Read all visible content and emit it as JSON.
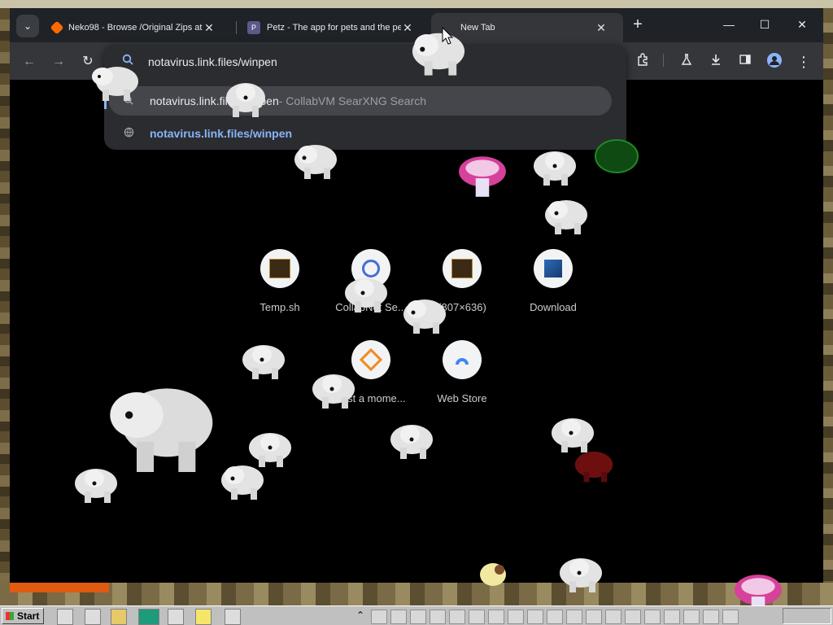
{
  "tabs": [
    {
      "title": "Neko98 - Browse /Original Zips at",
      "favicon": "sourceforge-diamond-icon",
      "favicon_color": "#ff6a00",
      "active": false
    },
    {
      "title": "Petz - The app for pets and the pe",
      "favicon": "petz-icon",
      "favicon_color": "#5a5a8a",
      "active": false
    },
    {
      "title": "New Tab",
      "favicon": "none",
      "active": true
    }
  ],
  "tab_strip": {
    "search_tabs_icon": "chevron-down-icon",
    "new_tab_label": "+"
  },
  "window_controls": {
    "minimize": "—",
    "maximize": "☐",
    "close": "✕"
  },
  "toolbar": {
    "back": "←",
    "forward": "→",
    "reload": "↻",
    "extensions_icon": "puzzle-icon",
    "labs_icon": "flask-icon",
    "downloads_icon": "download-icon",
    "side_panel_icon": "side-panel-icon",
    "profile_icon": "avatar-icon",
    "menu_icon": "kebab-icon"
  },
  "omnibox": {
    "value": "notavirus.link.files/winpen",
    "suggestions": [
      {
        "kind": "search",
        "text": "notavirus.link.files/winpen",
        "suffix": " - CollabVM SearXNG Search",
        "selected": true
      },
      {
        "kind": "url",
        "text": "notavirus.link.files/winpen",
        "selected": false
      }
    ]
  },
  "shortcuts": [
    {
      "label": "Temp.sh",
      "icon": "terminal-thumb-icon"
    },
    {
      "label": "CollabNet Se...",
      "icon": "search-ring-icon"
    },
    {
      "label": "(807×636)",
      "icon": "terminal-thumb-icon"
    },
    {
      "label": "Download",
      "icon": "blue-app-icon"
    },
    {
      "label": "Just a mome...",
      "icon": "orange-diamond-icon"
    },
    {
      "label": "Web Store",
      "icon": "web-store-icon"
    }
  ],
  "taskbar": {
    "start_label": "Start",
    "tray_time": ""
  },
  "colors": {
    "accent": "#8ab4f8",
    "tab_strip": "#1f2227",
    "toolbar": "#35363a",
    "ntp_bg": "#000000"
  }
}
